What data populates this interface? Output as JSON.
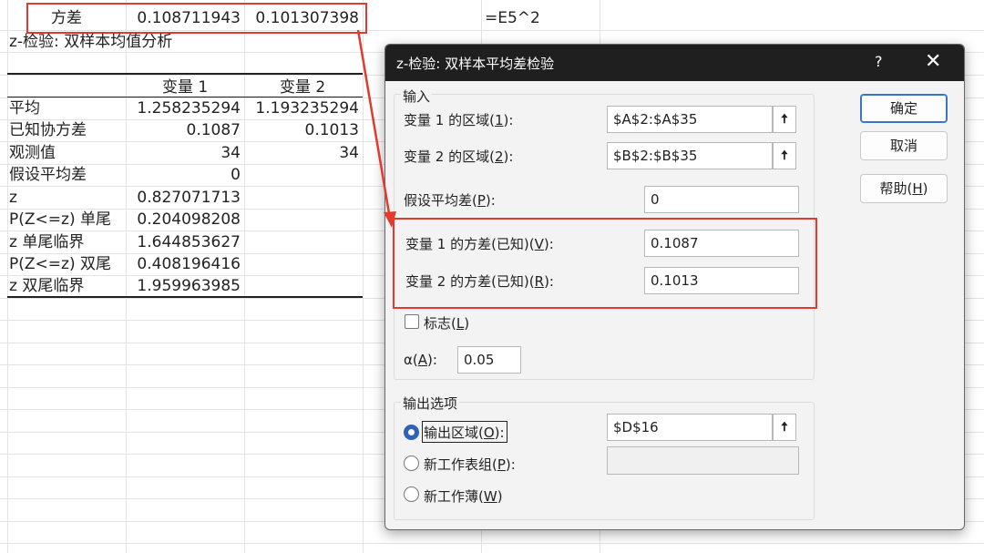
{
  "sheet": {
    "row_top": {
      "label": "方差",
      "v1": "0.108711943",
      "v2": "0.101307398",
      "formula": "=E5^2"
    },
    "table_title": "z-检验: 双样本均值分析",
    "header": {
      "col1": "变量 1",
      "col2": "变量 2"
    },
    "rows": [
      {
        "label": "平均",
        "v1": "1.258235294",
        "v2": "1.193235294"
      },
      {
        "label": "已知协方差",
        "v1": "0.1087",
        "v2": "0.1013"
      },
      {
        "label": "观测值",
        "v1": "34",
        "v2": "34"
      },
      {
        "label": "假设平均差",
        "v1": "0",
        "v2": ""
      },
      {
        "label": "z",
        "v1": "0.827071713",
        "v2": ""
      },
      {
        "label": "P(Z<=z) 单尾",
        "v1": "0.204098208",
        "v2": ""
      },
      {
        "label": "z 单尾临界",
        "v1": "1.644853627",
        "v2": ""
      },
      {
        "label": "P(Z<=z) 双尾",
        "v1": "0.408196416",
        "v2": ""
      },
      {
        "label": "z 双尾临界",
        "v1": "1.959963985",
        "v2": ""
      }
    ]
  },
  "dialog": {
    "title": "z-检验: 双样本平均差检验",
    "help_symbol": "?",
    "close_symbol": "✕",
    "input_group": {
      "title": "输入",
      "var1_range": {
        "label_pre": "变量 1 的区域(",
        "key": "1",
        "label_post": "):",
        "value": "$A$2:$A$35"
      },
      "var2_range": {
        "label_pre": "变量 2 的区域(",
        "key": "2",
        "label_post": "):",
        "value": "$B$2:$B$35"
      },
      "hyp_mean": {
        "label_pre": "假设平均差(",
        "key": "P",
        "label_post": "):",
        "value": "0"
      },
      "var1_variance": {
        "label_pre": "变量 1 的方差(已知)(",
        "key": "V",
        "label_post": "):",
        "value": "0.1087"
      },
      "var2_variance": {
        "label_pre": "变量 2 的方差(已知)(",
        "key": "R",
        "label_post": "):",
        "value": "0.1013"
      },
      "labels": {
        "label_pre": "标志(",
        "key": "L",
        "label_post": ")",
        "checked": false
      },
      "alpha": {
        "label_pre": "α(",
        "key": "A",
        "label_post": "):",
        "value": "0.05"
      }
    },
    "output_group": {
      "title": "输出选项",
      "output_range": {
        "label_pre": "输出区域(",
        "key": "O",
        "label_post": "):",
        "value": "$D$16",
        "checked": true
      },
      "new_sheet": {
        "label_pre": "新工作表组(",
        "key": "P",
        "label_post": "):",
        "value": "",
        "checked": false
      },
      "new_workbook": {
        "label_pre": "新工作薄(",
        "key": "W",
        "label_post": ")",
        "checked": false
      }
    },
    "buttons": {
      "ok": "确定",
      "cancel": "取消",
      "help_pre": "帮助(",
      "help_key": "H",
      "help_post": ")"
    },
    "ref_icon": "🠅"
  },
  "colors": {
    "annotation_red": "#e23a2e",
    "titlebar": "#1f1f1f",
    "radio_blue": "#2f62b8",
    "ok_border": "#3b73c7"
  },
  "icons": {
    "ref_button": "collapse-dialog-arrow-icon",
    "close": "close-icon",
    "help": "help-icon"
  }
}
